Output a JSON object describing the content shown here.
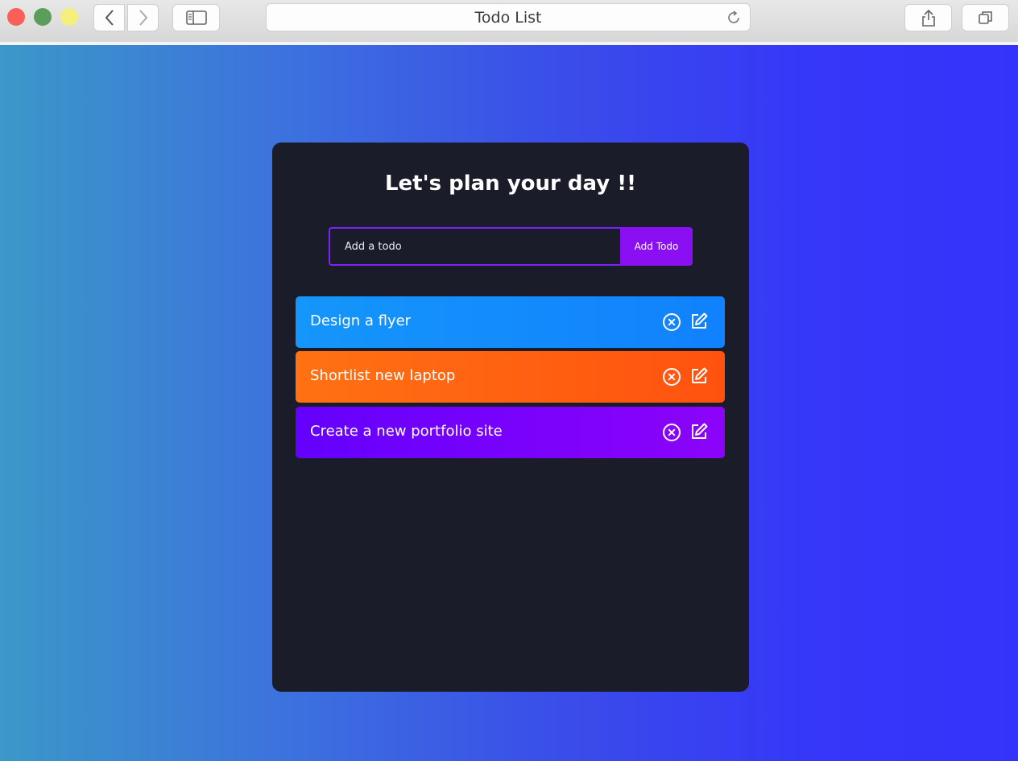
{
  "browser": {
    "tab_title": "Todo List"
  },
  "app": {
    "title": "Let's plan your day !!",
    "input": {
      "placeholder": "Add a todo",
      "value": ""
    },
    "add_button_label": "Add Todo",
    "colors": {
      "card_background": "#1a1c2a",
      "accent": "#8a10f3",
      "input_border": "#7b22ff"
    },
    "todos": [
      {
        "text": "Design a flyer",
        "gradient": [
          "#1596fb",
          "#1181fd"
        ],
        "icons": [
          "close-circle-icon",
          "edit-icon"
        ]
      },
      {
        "text": "Shortlist new laptop",
        "gradient": [
          "#ff7113",
          "#ff520f"
        ],
        "icons": [
          "close-circle-icon",
          "edit-icon"
        ]
      },
      {
        "text": "Create a new portfolio site",
        "gradient": [
          "#6400fd",
          "#8c03fa"
        ],
        "icons": [
          "close-circle-icon",
          "edit-icon"
        ]
      }
    ]
  }
}
